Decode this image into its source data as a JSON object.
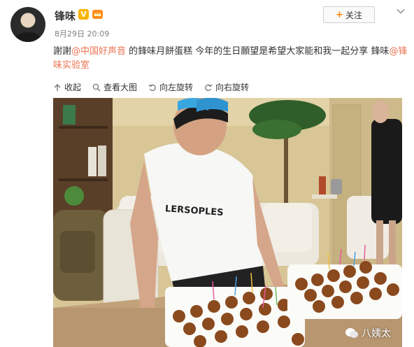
{
  "post": {
    "author": "锋味",
    "v_badge": "V",
    "time": "8月29日 20:09",
    "follow_label": "关注",
    "follow_plus": "+",
    "content": {
      "prefix": "謝謝",
      "mention1": "@中国好声音",
      "middle": " 的鋒味月餅蛋糕 今年的生日願望是希望大家能和我一起分享 鋒味",
      "mention2": "@锋味实验室"
    }
  },
  "toolbar": {
    "collapse": "收起",
    "view_large": "查看大图",
    "rotate_left": "向左旋转",
    "rotate_right": "向右旋转"
  },
  "photo": {
    "shirt_text": "LERSOPLES",
    "watermark": "八姨太"
  },
  "colors": {
    "link": "#eb7350",
    "accent": "#ff8200",
    "badge": "#f7b500"
  },
  "icons": [
    "collapse-icon",
    "zoom-icon",
    "rotate-left-icon",
    "rotate-right-icon",
    "chevron-down-icon",
    "crown-icon",
    "wechat-icon"
  ]
}
